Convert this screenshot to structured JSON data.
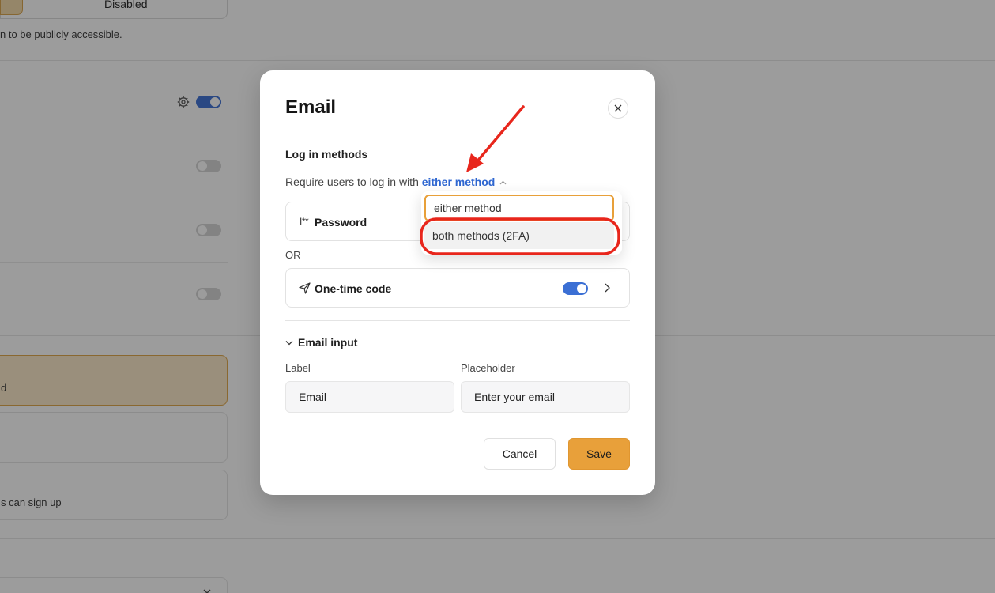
{
  "background": {
    "segment_label": "Disabled",
    "note": "n to be publicly accessible.",
    "card_warn_text": "d",
    "card_signup_text": "s can sign up"
  },
  "modal": {
    "title": "Email",
    "login_methods_label": "Log in methods",
    "require_prefix": "Require users to log in with",
    "require_value": "either method",
    "password_icon_text": "I**",
    "password_label": "Password",
    "or_label": "OR",
    "otc_label": "One-time code",
    "otc_enabled": true,
    "email_input_section": "Email input",
    "label_field_label": "Label",
    "label_field_value": "Email",
    "placeholder_field_label": "Placeholder",
    "placeholder_field_value": "Enter your email",
    "cancel_label": "Cancel",
    "save_label": "Save"
  },
  "dropdown": {
    "options": [
      "either method",
      "both methods (2FA)"
    ],
    "selected": "either method",
    "highlighted": "both methods (2FA)"
  },
  "colors": {
    "accent": "#e8a03a",
    "link": "#2f67d1",
    "toggle_on": "#3b6fd4",
    "annotation": "#e8261c"
  }
}
